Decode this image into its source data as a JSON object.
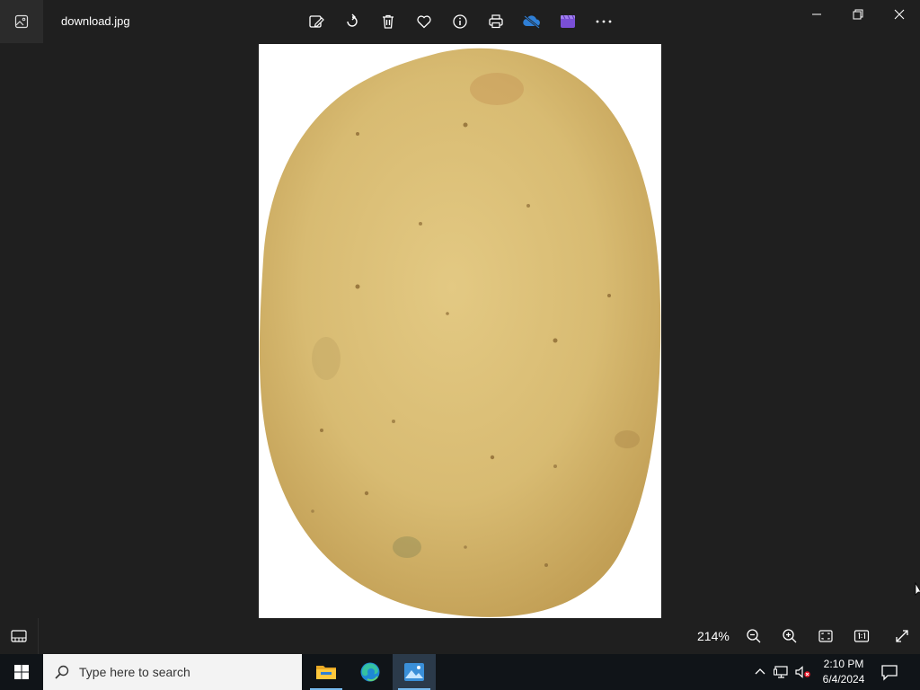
{
  "titlebar": {
    "file_name": "download.jpg",
    "toolbar_icons": [
      "edit-image-icon",
      "rotate-icon",
      "delete-icon",
      "favorite-icon",
      "info-icon",
      "print-icon",
      "onedrive-icon",
      "video-editor-icon",
      "more-icon"
    ],
    "window_controls": [
      "minimize-icon",
      "restore-icon",
      "close-icon"
    ]
  },
  "viewer": {
    "image_subject": "potato",
    "zoom_level": "214%",
    "bottom_icons": [
      "filmstrip-icon",
      "zoom-out-icon",
      "zoom-in-icon",
      "fit-to-window-icon",
      "actual-size-icon",
      "fullscreen-icon"
    ]
  },
  "taskbar": {
    "search_placeholder": "Type here to search",
    "pinned_apps": [
      "file-explorer-icon",
      "edge-icon",
      "photos-icon"
    ],
    "clock_time": "2:10 PM",
    "clock_date": "6/4/2024"
  },
  "colors": {
    "background": "#1f1f1f",
    "taskbar": "#101418",
    "accent": "#76b9ed",
    "potato": "#dcc17a"
  }
}
